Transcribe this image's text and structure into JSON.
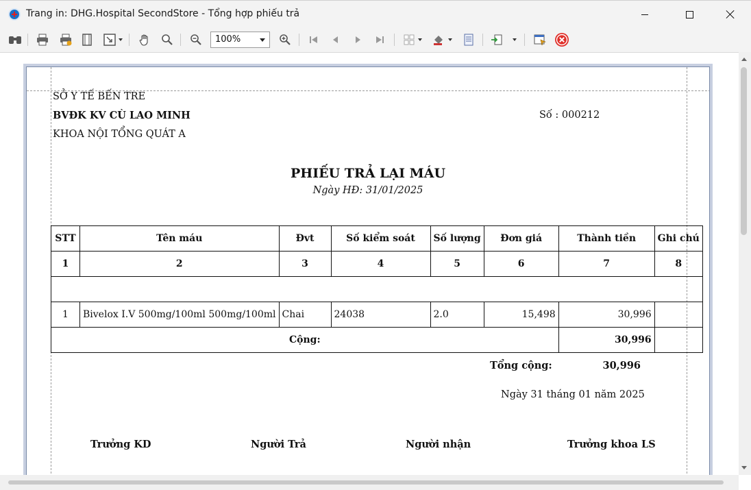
{
  "window": {
    "title": "Trang in: DHG.Hospital SecondStore - Tổng hợp phiếu trả"
  },
  "toolbar": {
    "zoom_value": "100%",
    "buttons": [
      "find-icon",
      "print-icon",
      "quick-print-icon",
      "page-setup-icon",
      "scale-icon",
      "hand-tool-icon",
      "magnifier-icon",
      "zoom-out-icon",
      "zoom-in-icon",
      "first-page-icon",
      "previous-page-icon",
      "next-page-icon",
      "last-page-icon",
      "multiple-pages-icon",
      "color-icon",
      "watermark-icon",
      "export-icon",
      "send-icon",
      "close-preview-icon"
    ]
  },
  "doc": {
    "dept_top": "SỞ Y TẾ BẾN TRE",
    "hospital": "BVĐK KV CÙ LAO MINH",
    "ward": "KHOA NỘI TỔNG QUÁT A",
    "doc_no": "Số : 000212",
    "title": "PHIẾU TRẢ LẠI MÁU",
    "date_line": "Ngày HĐ: 31/01/2025",
    "columns": [
      "STT",
      "Tên máu",
      "Đvt",
      "Số kiểm soát",
      "Số lượng",
      "Đơn giá",
      "Thành tiền",
      "Ghi chú"
    ],
    "col_numbers": [
      "1",
      "2",
      "3",
      "4",
      "5",
      "6",
      "7",
      "8"
    ],
    "rows": [
      {
        "stt": "1",
        "name": "Bivelox I.V 500mg/100ml 500mg/100ml",
        "unit": "Chai",
        "control_no": "24038",
        "qty": "2.0",
        "unit_price": "15,498",
        "amount": "30,996",
        "note": ""
      }
    ],
    "subtotal_label": "Cộng:",
    "subtotal_value": "30,996",
    "total_label": "Tổng cộng:",
    "total_value": "30,996",
    "sign_date": "Ngày 31 tháng 01 năm 2025",
    "signers": [
      "Trưởng KD",
      "Người Trả",
      "Người nhận",
      "Trưởng khoa LS"
    ]
  },
  "colors": {
    "close_preview_red": "#e0302a",
    "page_border": "#7a8aa8"
  }
}
